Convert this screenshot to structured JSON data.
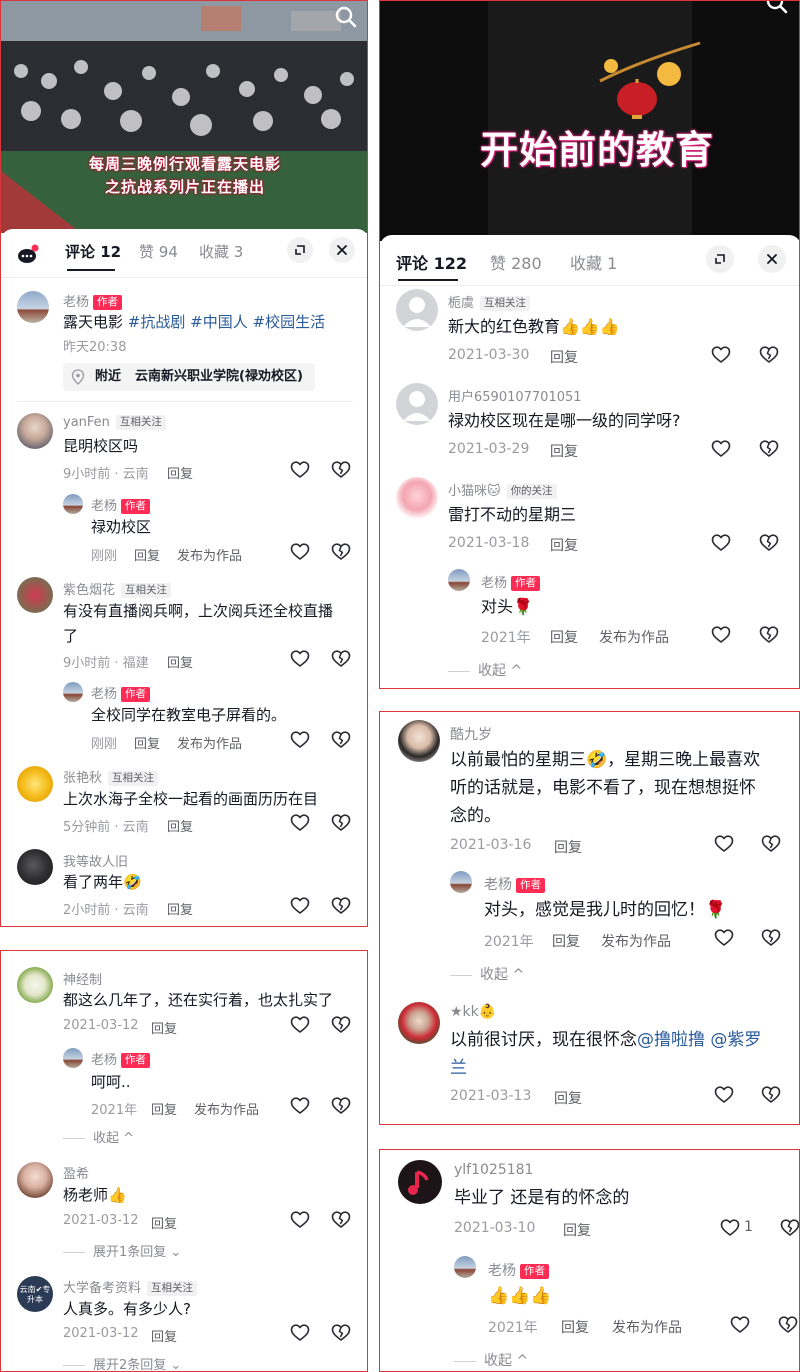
{
  "p1": {
    "overlay": [
      "每周三晚例行观看露天电影",
      "之抗战系列片正在播出"
    ],
    "tabs": [
      {
        "label": "评论",
        "count": "12"
      },
      {
        "label": "赞",
        "count": "94"
      },
      {
        "label": "收藏",
        "count": "3"
      }
    ],
    "post": {
      "author": "老杨",
      "author_tag": "作者",
      "text_plain": "露天电影 ",
      "hashtags": [
        "#抗战剧",
        "#中国人",
        "#校园生活"
      ],
      "time": "昨天20:38",
      "location_prefix": "附近",
      "location": "云南新兴职业学院(禄劝校区)"
    },
    "comments": [
      {
        "name": "yanFen",
        "tag": "互相关注",
        "text": "昆明校区吗",
        "meta": "9小时前 · 云南",
        "reply": "回复"
      },
      {
        "name": "老杨",
        "tag": "作者",
        "text": "禄劝校区",
        "meta": "刚刚",
        "reply": "回复",
        "publish": "发布为作品"
      },
      {
        "name": "紫色烟花",
        "tag": "互相关注",
        "text1": "有没有直播阅兵啊，上次阅兵还全校直播",
        "text2": "了",
        "meta": "9小时前 · 福建",
        "reply": "回复"
      },
      {
        "name": "老杨",
        "tag": "作者",
        "text": "全校同学在教室电子屏看的。",
        "meta": "刚刚",
        "reply": "回复",
        "publish": "发布为作品"
      },
      {
        "name": "张艳秋",
        "tag": "互相关注",
        "text": "上次水海子全校一起看的画面历历在目",
        "meta": "5分钟前 · 云南",
        "reply": "回复"
      },
      {
        "name": "我等故人旧",
        "text": "看了两年🤣",
        "meta": "2小时前 · 云南",
        "reply": "回复"
      }
    ]
  },
  "p2": {
    "comments": [
      {
        "name": "神经制",
        "text": "都这么几年了，还在实行着，也太扎实了",
        "meta": "2021-03-12",
        "reply": "回复"
      },
      {
        "name": "老杨",
        "tag": "作者",
        "text": "呵呵..",
        "meta": "2021年",
        "reply": "回复",
        "publish": "发布为作品"
      },
      {
        "collapse": "收起 ^"
      },
      {
        "name": "盈希",
        "text": "杨老师👍",
        "meta": "2021-03-12",
        "reply": "回复"
      },
      {
        "expand": "展开1条回复 ⌄"
      },
      {
        "name": "大学备考资料",
        "tag": "互相关注",
        "avatar_text": "云南✔专升本",
        "text": "人真多。有多少人?",
        "meta": "2021-03-12",
        "reply": "回复"
      },
      {
        "expand": "展开2条回复 ⌄"
      }
    ]
  },
  "p3": {
    "video_text": "开始前的教育",
    "tabs": [
      {
        "label": "评论",
        "count": "122"
      },
      {
        "label": "赞",
        "count": "280"
      },
      {
        "label": "收藏",
        "count": "1"
      }
    ],
    "comments": [
      {
        "name": "栀虞",
        "tag": "互相关注",
        "text": "新大的红色教育👍👍👍",
        "meta": "2021-03-30",
        "reply": "回复"
      },
      {
        "name": "用户6590107701051",
        "text": "禄劝校区现在是哪一级的同学呀?",
        "meta": "2021-03-29",
        "reply": "回复"
      },
      {
        "name": "小猫咪🐱",
        "tag": "你的关注",
        "text": "雷打不动的星期三",
        "meta": "2021-03-18",
        "reply": "回复"
      },
      {
        "name": "老杨",
        "tag": "作者",
        "text": "对头🌹",
        "meta": "2021年",
        "reply": "回复",
        "publish": "发布为作品"
      },
      {
        "collapse": "收起 ^"
      }
    ]
  },
  "p4": {
    "comments": [
      {
        "name": "酷九岁",
        "lines": [
          "以前最怕的星期三🤣，星期三晚上最喜欢",
          "听的话就是，电影不看了，现在想想挺怀",
          "念的。"
        ],
        "meta": "2021-03-16",
        "reply": "回复"
      },
      {
        "name": "老杨",
        "tag": "作者",
        "text": "对头，感觉是我儿时的回忆！🌹",
        "meta": "2021年",
        "reply": "回复",
        "publish": "发布为作品"
      },
      {
        "collapse": "收起 ^"
      },
      {
        "name": "★kk👶",
        "text_plain": "以前很讨厌，现在很怀念",
        "mention1": "@撸啦撸",
        "mention2": "@紫罗",
        "text_cont": "兰",
        "meta": "2021-03-13",
        "reply": "回复"
      }
    ]
  },
  "p5": {
    "comments": [
      {
        "name": "ylf1025181",
        "text": "毕业了 还是有的怀念的",
        "meta": "2021-03-10",
        "reply": "回复",
        "likes": "1"
      },
      {
        "name": "老杨",
        "tag": "作者",
        "text": "👍👍👍",
        "meta": "2021年",
        "reply": "回复",
        "publish": "发布为作品"
      },
      {
        "collapse": "收起 ^"
      }
    ]
  },
  "colors": {
    "accent": "#fe2c55",
    "frame": "#d9363e",
    "link": "#2a5b9a"
  }
}
